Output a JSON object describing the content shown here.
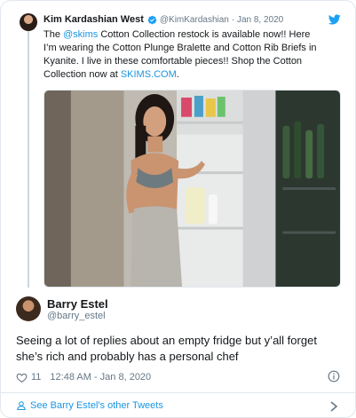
{
  "parent_tweet": {
    "author_name": "Kim Kardashian West",
    "author_handle": "@KimKardashian",
    "date": "· Jan 8, 2020",
    "text_before_link1": "The ",
    "link1": "@skims",
    "text_middle": " Cotton Collection restock is available now!! Here I’m wearing the Cotton Plunge Bralette and Cotton Rib Briefs in Kyanite. I live in these comfortable pieces!! Shop the Cotton Collection now at ",
    "link2": "SKIMS.COM",
    "text_after_link2": "."
  },
  "main_tweet": {
    "author_name": "Barry Estel",
    "author_handle": "@barry_estel",
    "text": "Seeing a lot of replies about an empty fridge but y’all forget she’s rich and probably has a personal chef",
    "like_count": "11",
    "timestamp": "12:48 AM - Jan 8, 2020"
  },
  "footer": {
    "other_tweets_label": "See Barry Estel's other Tweets"
  },
  "icons": {
    "verified": "verified-badge-icon",
    "brand": "twitter-bird-icon",
    "like": "heart-icon",
    "info": "info-icon",
    "profile": "person-icon",
    "more": "chevron-right-icon"
  },
  "colors": {
    "link": "#1b95e0",
    "muted": "#657786",
    "border": "#e1e8ed",
    "text": "#14171a"
  }
}
